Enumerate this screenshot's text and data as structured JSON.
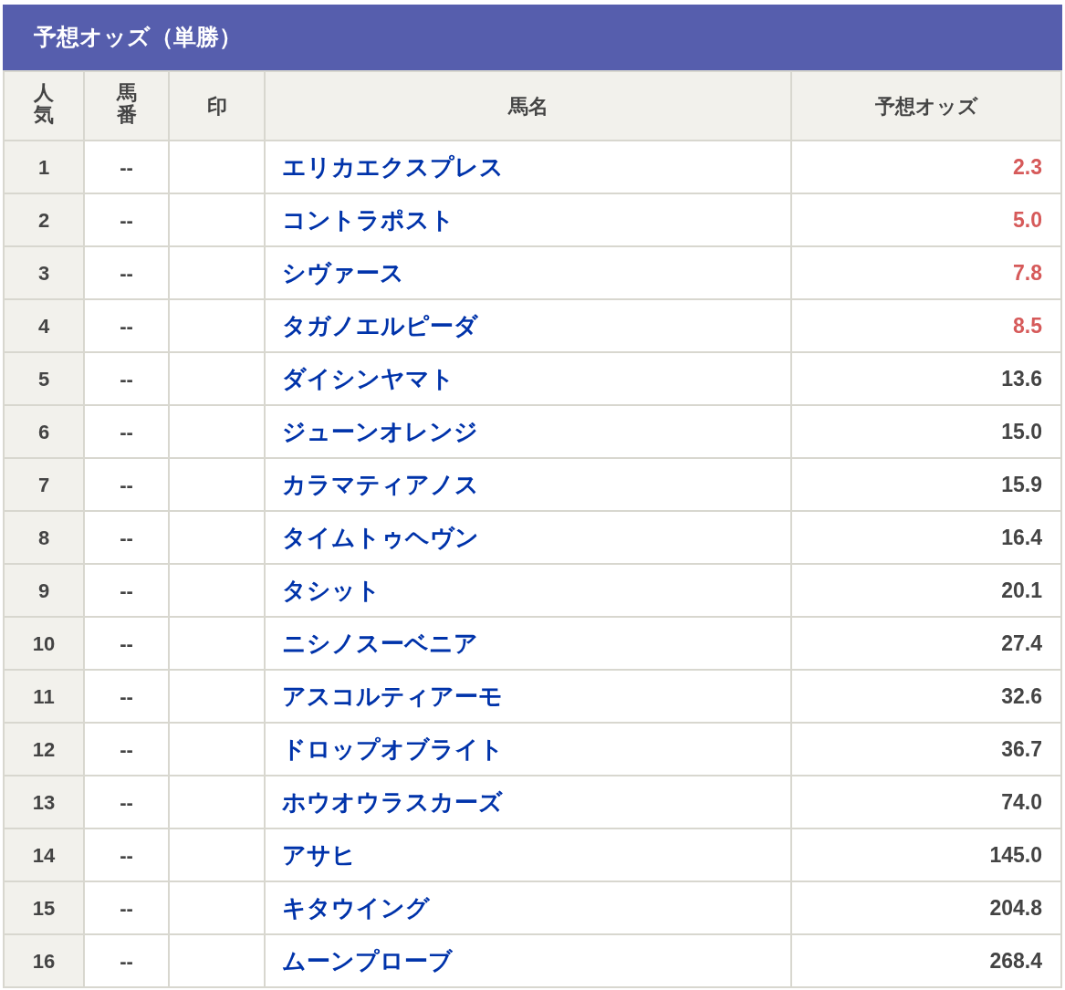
{
  "title": "予想オッズ（単勝）",
  "table": {
    "columns": [
      {
        "label": "人気",
        "kind": "vertical"
      },
      {
        "label": "馬番",
        "kind": "vertical"
      },
      {
        "label": "印",
        "kind": "plain"
      },
      {
        "label": "馬名",
        "kind": "plain"
      },
      {
        "label": "予想オッズ",
        "kind": "plain"
      }
    ],
    "rows": [
      {
        "rank": "1",
        "number": "--",
        "name": "エリカエクスプレス",
        "odds": "2.3",
        "favorite": true
      },
      {
        "rank": "2",
        "number": "--",
        "name": "コントラポスト",
        "odds": "5.0",
        "favorite": true
      },
      {
        "rank": "3",
        "number": "--",
        "name": "シヴァース",
        "odds": "7.8",
        "favorite": true
      },
      {
        "rank": "4",
        "number": "--",
        "name": "タガノエルピーダ",
        "odds": "8.5",
        "favorite": true
      },
      {
        "rank": "5",
        "number": "--",
        "name": "ダイシンヤマト",
        "odds": "13.6",
        "favorite": false
      },
      {
        "rank": "6",
        "number": "--",
        "name": "ジューンオレンジ",
        "odds": "15.0",
        "favorite": false
      },
      {
        "rank": "7",
        "number": "--",
        "name": "カラマティアノス",
        "odds": "15.9",
        "favorite": false
      },
      {
        "rank": "8",
        "number": "--",
        "name": "タイムトゥヘヴン",
        "odds": "16.4",
        "favorite": false
      },
      {
        "rank": "9",
        "number": "--",
        "name": "タシット",
        "odds": "20.1",
        "favorite": false
      },
      {
        "rank": "10",
        "number": "--",
        "name": "ニシノスーベニア",
        "odds": "27.4",
        "favorite": false
      },
      {
        "rank": "11",
        "number": "--",
        "name": "アスコルティアーモ",
        "odds": "32.6",
        "favorite": false
      },
      {
        "rank": "12",
        "number": "--",
        "name": "ドロップオブライト",
        "odds": "36.7",
        "favorite": false
      },
      {
        "rank": "13",
        "number": "--",
        "name": "ホウオウラスカーズ",
        "odds": "74.0",
        "favorite": false
      },
      {
        "rank": "14",
        "number": "--",
        "name": "アサヒ",
        "odds": "145.0",
        "favorite": false
      },
      {
        "rank": "15",
        "number": "--",
        "name": "キタウイング",
        "odds": "204.8",
        "favorite": false
      },
      {
        "rank": "16",
        "number": "--",
        "name": "ムーンプローブ",
        "odds": "268.4",
        "favorite": false
      }
    ]
  }
}
